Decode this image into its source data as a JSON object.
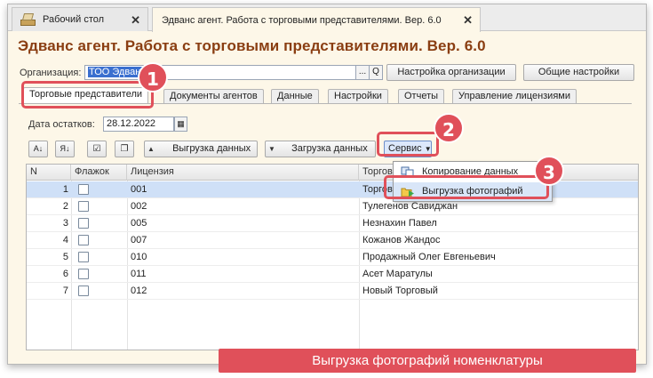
{
  "window_tabs": [
    {
      "label": "Рабочий стол"
    },
    {
      "label": "Эдванс агент. Работа с торговыми представителями. Вер. 6.0"
    }
  ],
  "title": "Эдванс агент. Работа с торговыми представителями. Вер. 6.0",
  "org": {
    "label": "Организация:",
    "value": "ТОО Эдванс",
    "select_btn": "...",
    "search_btn": "Q"
  },
  "buttons": {
    "org_settings": "Настройка организации",
    "general_settings": "Общие настройки"
  },
  "form_tabs": [
    "Торговые представители",
    "Документы агентов",
    "Данные",
    "Настройки",
    "Отчеты",
    "Управление лицензиями"
  ],
  "date": {
    "label": "Дата остатков:",
    "value": "28.12.2022"
  },
  "toolbar": {
    "upload": "Выгрузка данных",
    "download": "Загрузка данных",
    "service": "Сервис"
  },
  "grid": {
    "headers": [
      "N",
      "Флажок",
      "Лицензия",
      "Торговый представитель"
    ],
    "rows": [
      {
        "n": "1",
        "license": "001",
        "agent": "Торговый Агент"
      },
      {
        "n": "2",
        "license": "002",
        "agent": "Тулегенов Савиджан"
      },
      {
        "n": "3",
        "license": "005",
        "agent": "Незнахин Павел"
      },
      {
        "n": "4",
        "license": "007",
        "agent": "Кожанов Жандос"
      },
      {
        "n": "5",
        "license": "010",
        "agent": "Продажный Олег Евгеньевич"
      },
      {
        "n": "6",
        "license": "011",
        "agent": "Асет Маратулы"
      },
      {
        "n": "7",
        "license": "012",
        "agent": "Новый Торговый"
      }
    ]
  },
  "menu": {
    "items": [
      "Копирование данных",
      "Выгрузка фотографий"
    ]
  },
  "badges": [
    "1",
    "2",
    "3"
  ],
  "caption": "Выгрузка фотографий номенклатуры",
  "colors": {
    "accent": "#e0505a",
    "title": "#8a3e12",
    "selection": "#3a6fcf"
  }
}
